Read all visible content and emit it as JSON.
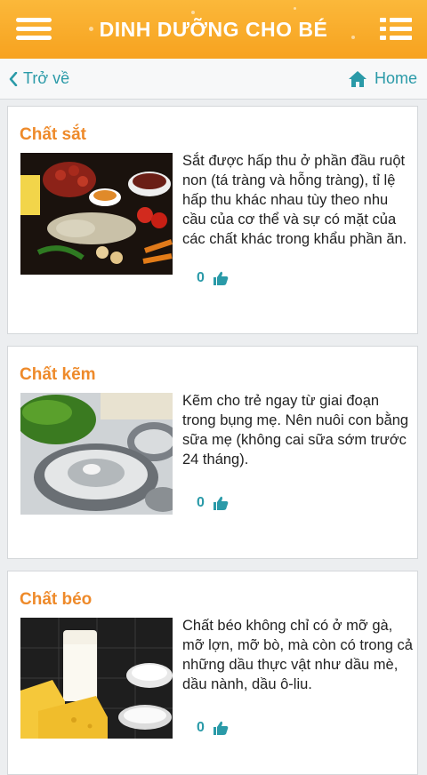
{
  "header": {
    "title": "DINH DƯỠNG CHO BÉ"
  },
  "nav": {
    "back_label": "Trở về",
    "home_label": "Home"
  },
  "items": [
    {
      "title": "Chất sắt",
      "description": "Sắt được hấp thu ở phần đầu ruột non (tá tràng và hỗng tràng), tỉ lệ hấp thu khác nhau tùy theo nhu cầu của cơ thể và sự có mặt của các chất khác trong khẩu phần ăn.",
      "likes": "0"
    },
    {
      "title": "Chất kẽm",
      "description": "Kẽm cho trẻ ngay từ giai đoạn trong bụng mẹ. Nên nuôi con bằng sữa mẹ (không cai sữa sớm trước 24 tháng).",
      "likes": "0"
    },
    {
      "title": "Chất béo",
      "description": "Chất béo không chỉ có ở mỡ gà, mỡ lợn, mỡ bò, mà còn có  trong cả những dầu thực vật như dầu mè, dầu nành, dầu ô-liu.",
      "likes": "0"
    }
  ],
  "colors": {
    "header_orange": "#f7a21f",
    "teal": "#2a9aa8",
    "title_orange": "#ee8a2a"
  }
}
